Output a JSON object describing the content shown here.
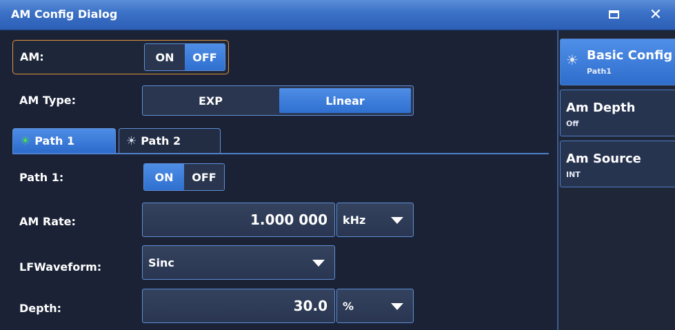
{
  "window": {
    "title": "AM Config Dialog"
  },
  "am": {
    "label": "AM:",
    "on_label": "ON",
    "off_label": "OFF",
    "selected": "OFF"
  },
  "am_type": {
    "label": "AM Type:",
    "options": [
      "EXP",
      "Linear"
    ],
    "selected": "Linear"
  },
  "tabs": [
    {
      "label": "Path 1",
      "active": true,
      "icon": "sun-icon"
    },
    {
      "label": "Path 2",
      "active": false,
      "icon": "sun-icon"
    }
  ],
  "path1": {
    "label": "Path 1:",
    "on_label": "ON",
    "off_label": "OFF",
    "selected": "ON"
  },
  "am_rate": {
    "label": "AM Rate:",
    "value": "1.000 000",
    "unit": "kHz"
  },
  "lf_waveform": {
    "label": "LFWaveform:",
    "value": "Sinc"
  },
  "depth": {
    "label": "Depth:",
    "value": "30.0",
    "unit": "%"
  },
  "side": {
    "items": [
      {
        "title": "Basic Config",
        "sub": "Path1",
        "active": true
      },
      {
        "title": "Am Depth",
        "sub": "Off",
        "active": false
      },
      {
        "title": "Am Source",
        "sub": "INT",
        "active": false
      }
    ]
  },
  "colors": {
    "accent": "#2f6fcf",
    "frame_highlight": "#e0953a",
    "active_tab_icon": "#49e04b"
  }
}
